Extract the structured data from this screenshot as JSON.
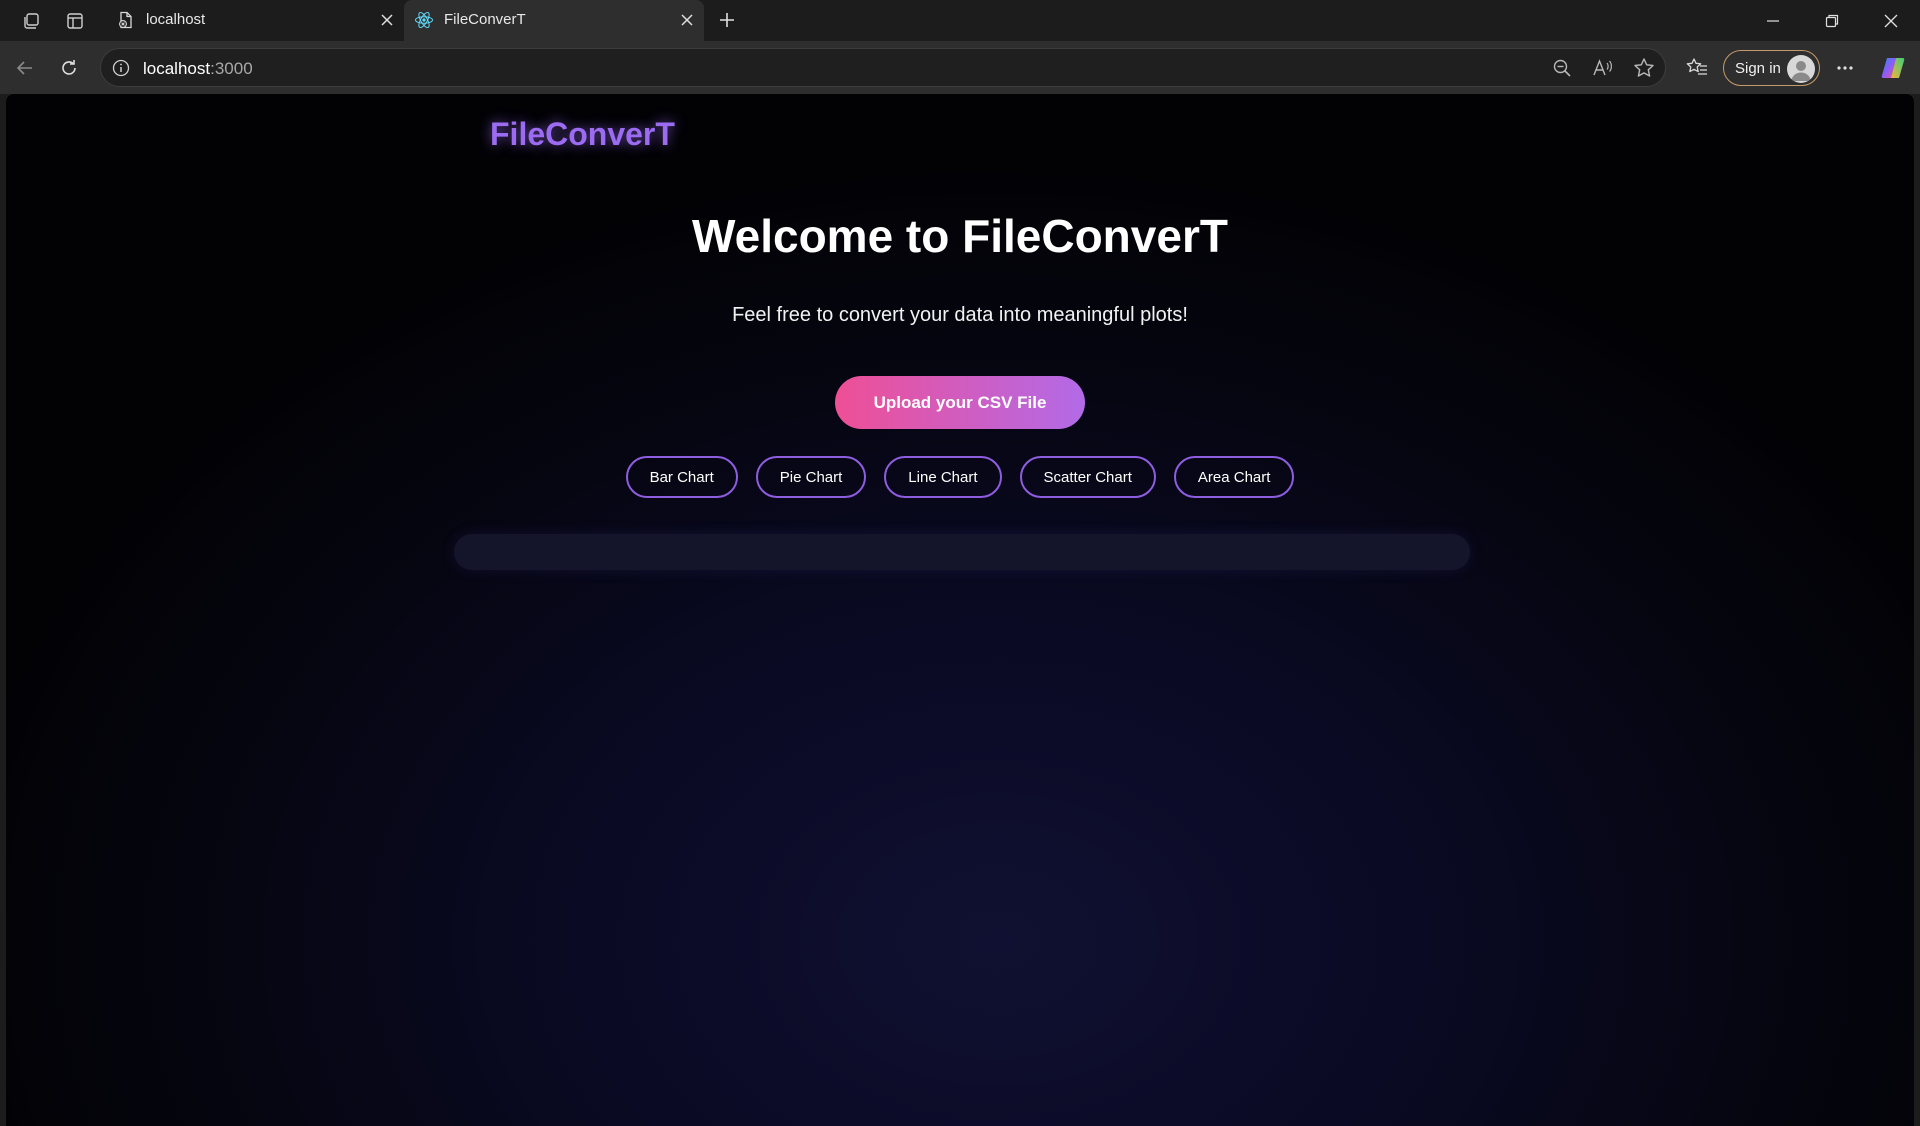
{
  "browser": {
    "tabs": [
      {
        "title": "localhost",
        "icon": "file-icon"
      },
      {
        "title": "FileConverT",
        "icon": "react-icon",
        "active": true
      }
    ],
    "address": {
      "host": "localhost",
      "port": ":3000"
    },
    "signin_label": "Sign in"
  },
  "page": {
    "brand": "FileConverT",
    "headline": "Welcome to FileConverT",
    "subline": "Feel free to convert your data into meaningful plots!",
    "upload_label": "Upload your CSV File",
    "chart_buttons": [
      "Bar Chart",
      "Pie Chart",
      "Line Chart",
      "Scatter Chart",
      "Area Chart"
    ]
  },
  "colors": {
    "accent_purple": "#9b6cf2",
    "upload_gradient_start": "#ef4f95",
    "upload_gradient_end": "#b26ae8",
    "chart_button_border": "#8f5de0"
  }
}
